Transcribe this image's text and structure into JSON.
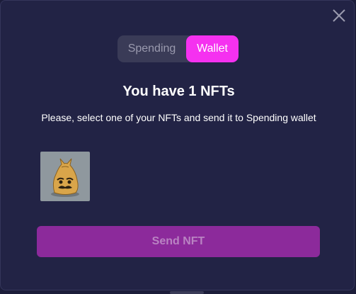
{
  "modal": {
    "close_icon": "close-icon",
    "tabs": [
      {
        "label": "Spending",
        "active": false
      },
      {
        "label": "Wallet",
        "active": true
      }
    ],
    "title": "You have 1 NFTs",
    "subtitle": "Please, select one of your NFTs and send it to Spending wallet",
    "nfts": [
      {
        "image": "golden-blob-creature"
      }
    ],
    "send_button": "Send NFT"
  },
  "colors": {
    "background": "#222345",
    "accent": "#f531f0",
    "button": "#8c2a9b",
    "button_text": "#b983c2"
  }
}
